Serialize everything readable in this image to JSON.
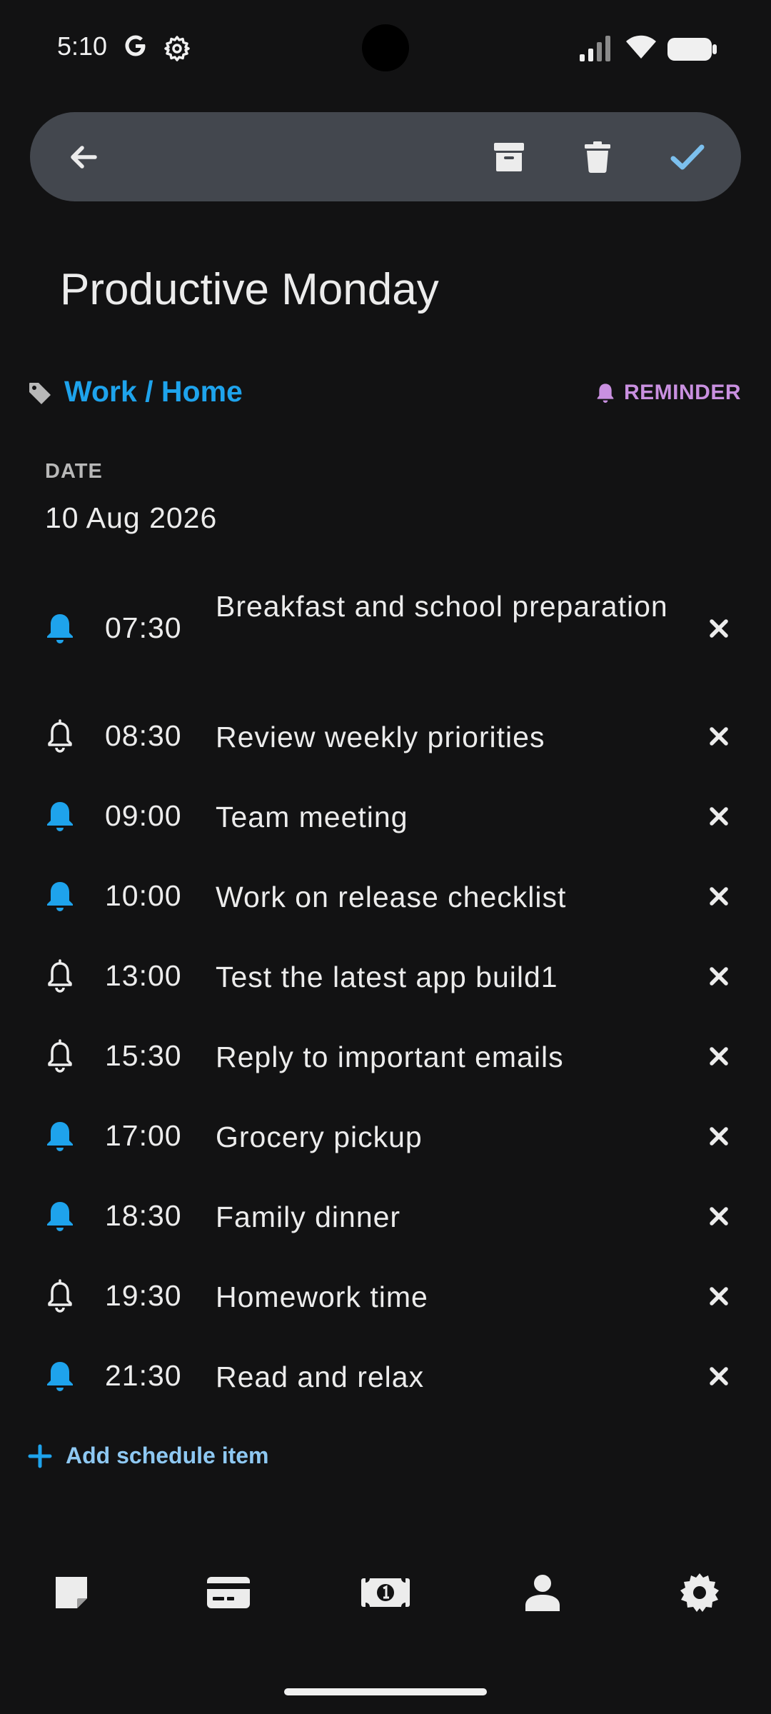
{
  "status_bar": {
    "time": "5:10",
    "icons": [
      "google-g-icon",
      "settings-gear-icon",
      "signal-icon",
      "wifi-icon",
      "battery-icon"
    ]
  },
  "toolbar": {
    "icons": [
      "back-arrow-icon",
      "archive-icon",
      "trash-icon",
      "check-icon"
    ],
    "check_color": "#7CC0EE"
  },
  "note": {
    "title": "Productive Monday",
    "tags": "Work / Home",
    "reminder_label": "REMINDER",
    "date_label": "DATE",
    "date_value": "10 Aug 2026"
  },
  "colors": {
    "accent_blue": "#1EA3EC",
    "reminder_purple": "#C990E0",
    "add_blue": "#8EC8F2",
    "toolbar_bg": "#43474E",
    "background": "#121213"
  },
  "schedule": [
    {
      "time": "07:30",
      "task": "Breakfast and school preparation",
      "reminder_on": true
    },
    {
      "time": "08:30",
      "task": "Review weekly priorities",
      "reminder_on": false
    },
    {
      "time": "09:00",
      "task": "Team meeting",
      "reminder_on": true
    },
    {
      "time": "10:00",
      "task": "Work on release checklist",
      "reminder_on": true
    },
    {
      "time": "13:00",
      "task": "Test the latest app build1",
      "reminder_on": false
    },
    {
      "time": "15:30",
      "task": "Reply to important emails",
      "reminder_on": false
    },
    {
      "time": "17:00",
      "task": "Grocery pickup",
      "reminder_on": true
    },
    {
      "time": "18:30",
      "task": "Family dinner",
      "reminder_on": true
    },
    {
      "time": "19:30",
      "task": "Homework time",
      "reminder_on": false
    },
    {
      "time": "21:30",
      "task": "Read and relax",
      "reminder_on": true
    }
  ],
  "add_item": {
    "label": "Add schedule item"
  },
  "bottom_nav": {
    "items": [
      "notes-icon",
      "card-icon",
      "cash-icon",
      "person-icon",
      "settings-icon"
    ]
  }
}
